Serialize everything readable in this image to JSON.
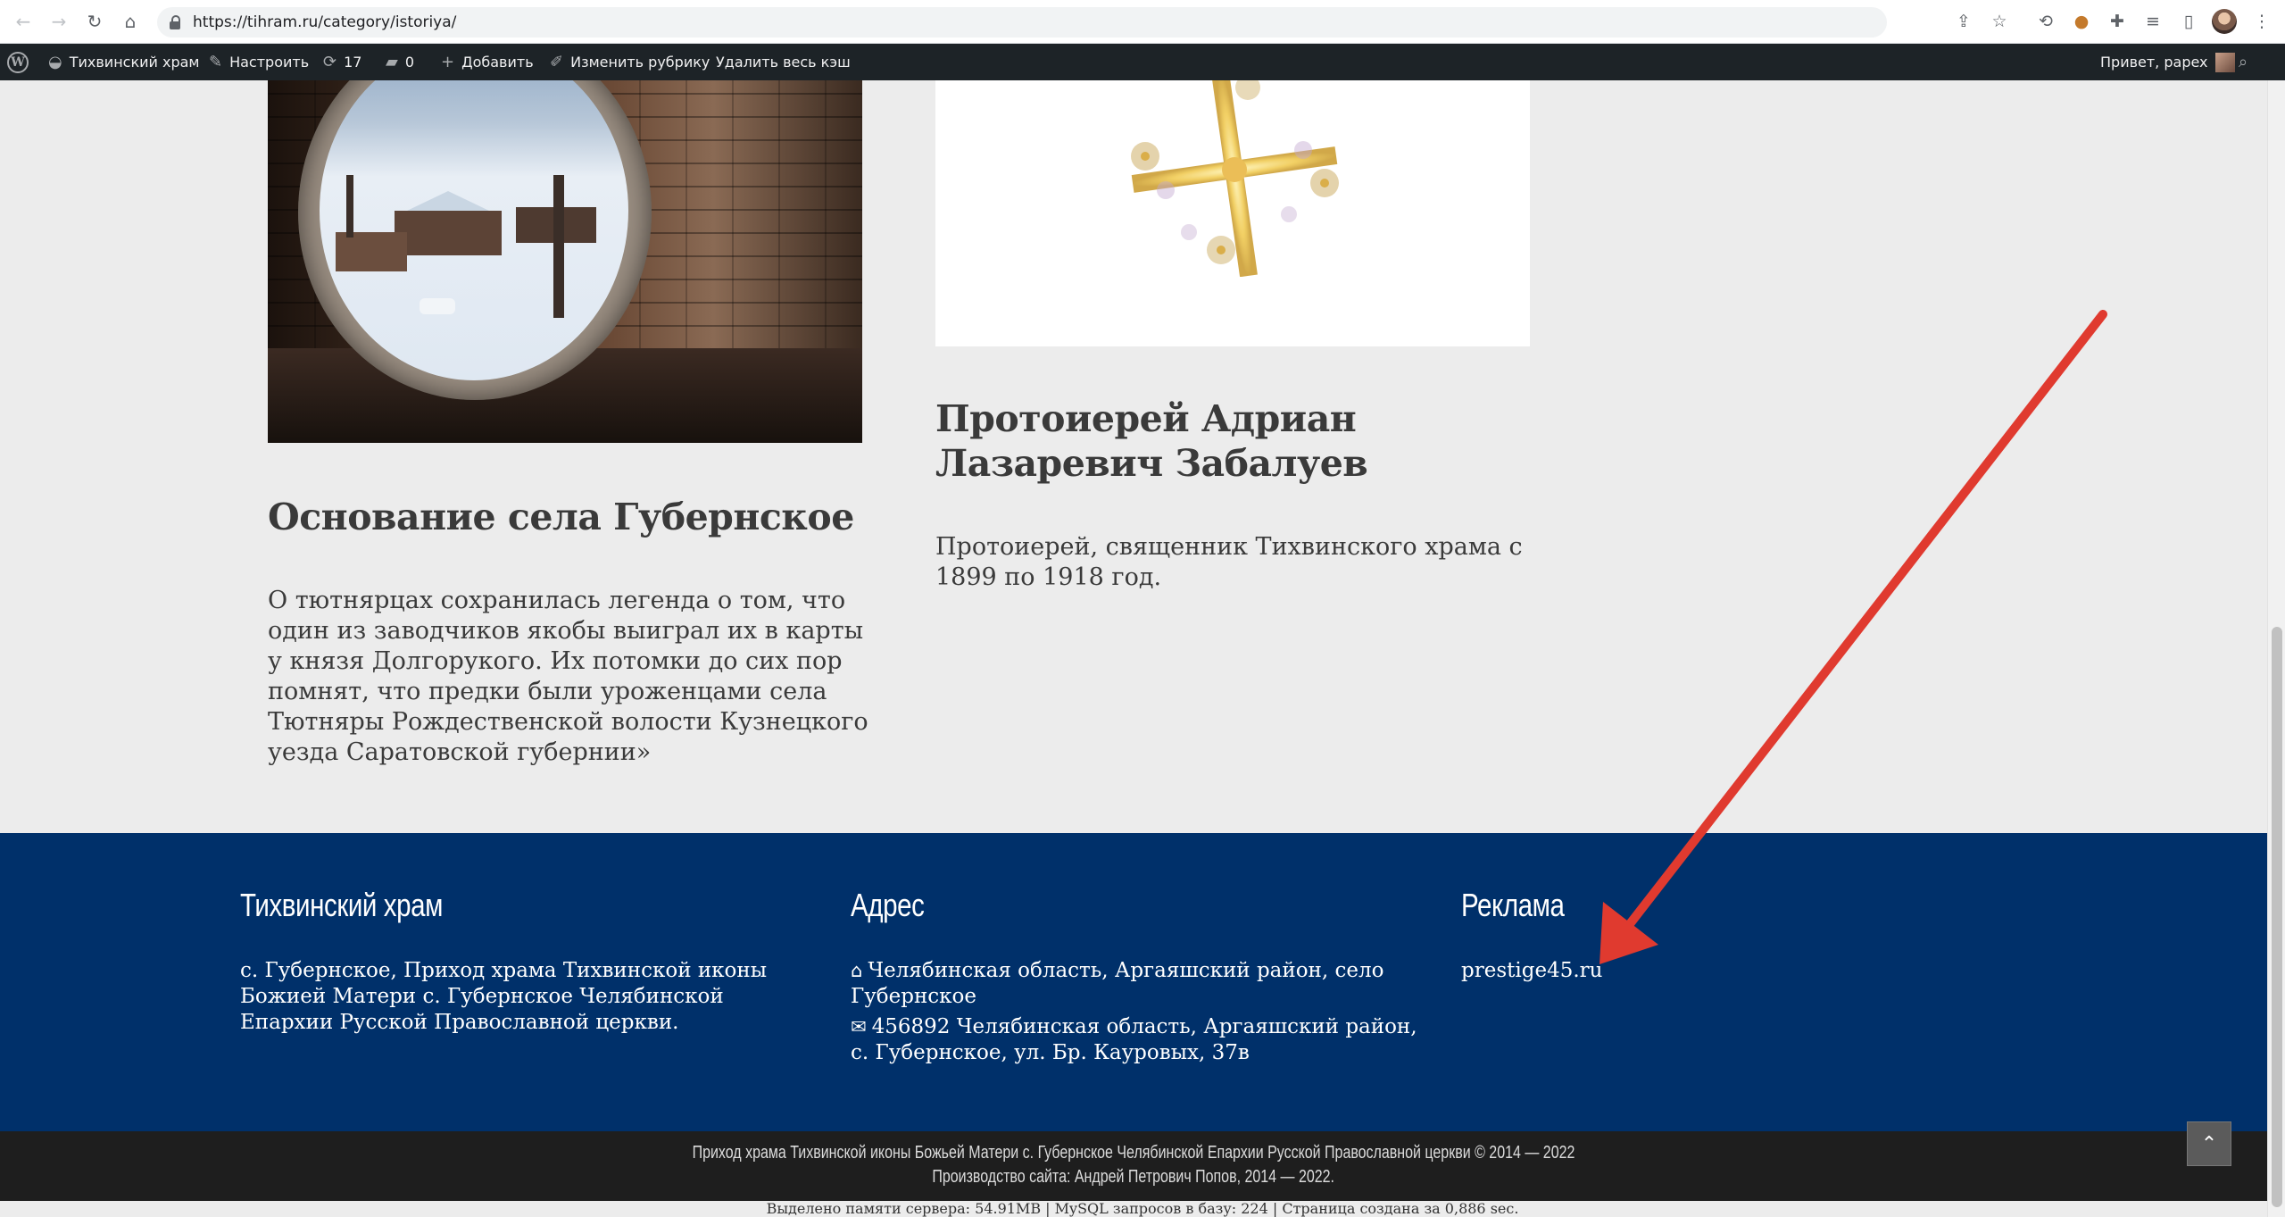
{
  "browser": {
    "url": "https://tihram.ru/category/istoriya/"
  },
  "admin_bar": {
    "site_name": "Тихвинский храм",
    "customize": "Настроить",
    "updates_count": "17",
    "comments_count": "0",
    "add_new": "Добавить",
    "edit_category": "Изменить рубрику",
    "clear_cache": "Удалить весь кэш",
    "greeting": "Привет, papex"
  },
  "posts": [
    {
      "title": "Основание села Губернское",
      "excerpt": "О тютнярцах сохранилась легенда о том, что один из заводчиков якобы выиграл их в карты у князя Долгорукого. Их потомки до сих пор помнят, что предки были уроженцами села Тютняры Рождественской волости Кузнецкого уезда Саратовской губернии»"
    },
    {
      "title": "Протоиерей Адриан Лазаревич Забалуев",
      "excerpt": "Протоиерей, священник Тихвинского храма с 1899 по 1918 год."
    }
  ],
  "footer": {
    "about": {
      "heading": "Тихвинский храм",
      "text": "с. Губернское, Приход храма Тихвинской иконы Божией Матери с. Губернское Челябинской Епархии Русской Православной церкви."
    },
    "address": {
      "heading": "Адрес",
      "location": "Челябинская область, Аргаяшский район, село Губернское",
      "postal": "456892 Челябинская область, Аргаяшский район, с. Губернское, ул. Бр. Кауровых, 37в"
    },
    "ads": {
      "heading": "Реклама",
      "link": "prestige45.ru"
    }
  },
  "bottom": {
    "copyright": "Приход храма Тихвинской иконы Божьей Матери с. Губернское Челябинской Епархии Русской Православной церкви © 2014 — 2022",
    "credits": "Производство сайта: Андрей Петрович Попов, 2014 — 2022.",
    "server_stats": "Выделено памяти сервера: 54.91MB | MySQL запросов в базу: 224 | Страница создана за 0,886 sec."
  },
  "icons": {
    "back": "arrow-left-icon",
    "forward": "arrow-right-icon",
    "reload": "reload-icon",
    "home": "home-icon",
    "lock": "lock-icon",
    "share": "share-icon",
    "bookmark": "star-icon",
    "extensions": "puzzle-icon",
    "home_address": "home-icon",
    "envelope": "envelope-icon",
    "scroll_top": "chevron-up-icon"
  },
  "colors": {
    "footer_bg": "#00306a",
    "admin_bar_bg": "#1d2327",
    "page_bg": "#ececec",
    "bottom_bar_bg": "#1e1e1e",
    "arrow": "#e03a2f"
  }
}
